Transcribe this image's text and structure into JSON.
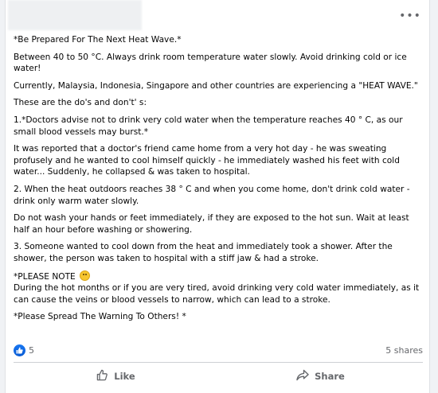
{
  "header": {
    "more_icon": "more-horizontal-icon",
    "more_glyph": "•••"
  },
  "post": {
    "paragraphs": [
      "*Be Prepared For The Next Heat Wave.*",
      "Between 40 to 50 °C. Always drink room temperature water slowly. Avoid drinking cold or ice water!",
      "Currently, Malaysia, Indonesia, Singapore and other countries are experiencing a \"HEAT WAVE.\"",
      "These are the do's and don't' s:",
      "1.*Doctors advise not to drink very cold water when the temperature reaches 40 ° C, as our small blood vessels may burst.*",
      "It was reported that a doctor's friend came home from a very hot day - he was sweating profusely and he wanted to cool himself quickly - he immediately washed his feet with cold water... Suddenly, he collapsed & was taken to hospital.",
      " 2. When the heat outdoors reaches 38 ° C and when you come home,  don't drink cold water - drink only warm water slowly.",
      "Do not wash your hands or feet immediately, if they are exposed to the hot sun. Wait at least half an hour before washing or showering.",
      " 3. Someone wanted to cool down from the heat and immediately took a shower. After the shower, the person was taken to hospital with a stiff jaw & had a stroke."
    ],
    "note_label": "*PLEASE NOTE ",
    "note_icon": "smiley-emoji-icon",
    "note_text": "During the hot months or if you are very tired, avoid drinking very cold water immediately, as it can cause the veins or blood vessels to narrow, which can lead to a stroke.",
    "closing": "*Please Spread The Warning To Others! *"
  },
  "stats": {
    "reaction_icon": "like-reaction-icon",
    "reaction_count": "5",
    "shares": "5 shares"
  },
  "actions": {
    "like_label": "Like",
    "like_icon": "thumbs-up-icon",
    "share_label": "Share",
    "share_icon": "share-arrow-icon"
  },
  "colors": {
    "background": "#f0f2f5",
    "card": "#ffffff",
    "text": "#050505",
    "secondary_text": "#65676b",
    "like_blue": "#1877f2"
  }
}
